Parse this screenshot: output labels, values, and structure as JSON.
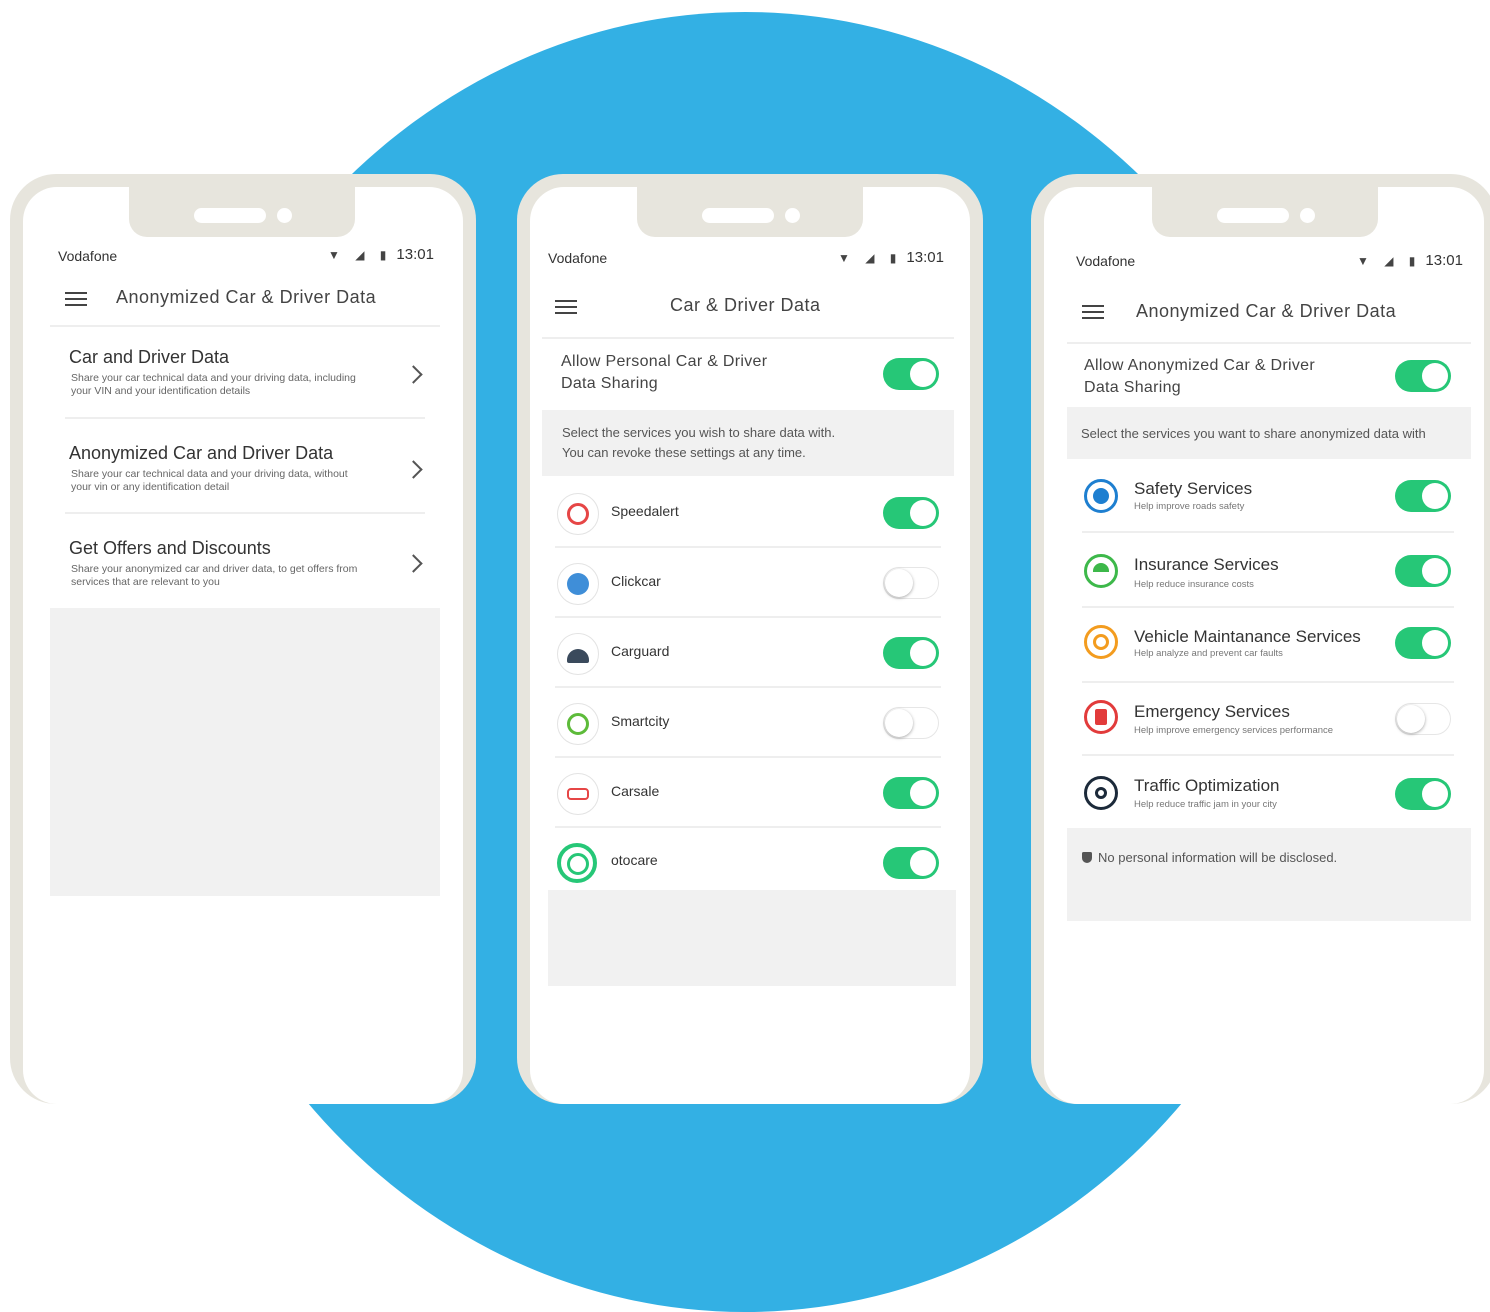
{
  "status": {
    "carrier": "Vodafone",
    "time": "13:01",
    "signal_icons": "▼ ◢ ▮"
  },
  "phone1": {
    "title": "Anonymized Car & Driver Data",
    "items": [
      {
        "title": "Car and Driver Data",
        "desc": "Share your car technical data and your driving data, including your VIN and your identification details"
      },
      {
        "title": "Anonymized Car and Driver Data",
        "desc": "Share your car technical data and your driving data, without your vin or any identification detail"
      },
      {
        "title": "Get Offers and Discounts",
        "desc": "Share your anonymized car and driver data, to get offers from services that are relevant to you"
      }
    ]
  },
  "phone2": {
    "title": "Car & Driver Data",
    "allow_line1": "Allow Personal Car & Driver",
    "allow_line2": "Data Sharing",
    "allow_on": true,
    "info_line1": "Select the services you wish to share data with.",
    "info_line2": "You can revoke these settings at any time.",
    "services": [
      {
        "name": "Speedalert",
        "icon": "speed-alert-icon",
        "on": true,
        "color": "#e64646"
      },
      {
        "name": "Clickcar",
        "icon": "cloud-icon",
        "on": false,
        "color": "#3f8ed8"
      },
      {
        "name": "Carguard",
        "icon": "siren-icon",
        "on": true,
        "color": "#3a4a5c"
      },
      {
        "name": "Smartcity",
        "icon": "globe-icon",
        "on": false,
        "color": "#5dbb3a"
      },
      {
        "name": "Carsale",
        "icon": "car-sale-icon",
        "on": true,
        "color": "#e64646"
      },
      {
        "name": "otocare",
        "icon": "otocare-icon",
        "on": true,
        "color": "#26c777"
      }
    ]
  },
  "phone3": {
    "title": "Anonymized Car & Driver Data",
    "allow_line1": "Allow Anonymized Car & Driver",
    "allow_line2": "Data Sharing",
    "allow_on": true,
    "info": "Select the services you want to share anonymized data with",
    "categories": [
      {
        "title": "Safety Services",
        "sub": "Help improve roads safety",
        "icon": "seatbelt-icon",
        "color": "#1e7fd0",
        "on": true
      },
      {
        "title": "Insurance Services",
        "sub": "Help reduce insurance costs",
        "icon": "umbrella-icon",
        "color": "#3db84a",
        "on": true
      },
      {
        "title": "Vehicle Maintanance Services",
        "sub": "Help analyze and prevent car faults",
        "icon": "gear-icon",
        "color": "#f39c1f",
        "on": true
      },
      {
        "title": "Emergency Services",
        "sub": "Help improve emergency services performance",
        "icon": "cone-icon",
        "color": "#e23b3b",
        "on": false
      },
      {
        "title": "Traffic Optimization",
        "sub": "Help reduce traffic jam in your city",
        "icon": "steering-wheel-icon",
        "color": "#1c2a3a",
        "on": true
      }
    ],
    "note": "No personal information will be disclosed."
  },
  "colors": {
    "background_circle": "#33b0e4",
    "phone_frame": "#e7e5dd",
    "toggle_on": "#26c777"
  }
}
